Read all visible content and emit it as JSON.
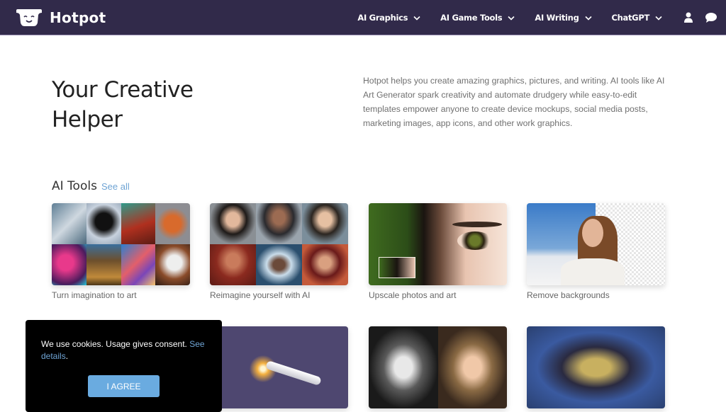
{
  "brand": {
    "name": "Hotpot",
    "bg_color": "#312a4a"
  },
  "nav": {
    "items": [
      {
        "label": "AI Graphics"
      },
      {
        "label": "AI Game Tools"
      },
      {
        "label": "AI Writing"
      },
      {
        "label": "ChatGPT"
      }
    ],
    "icons": [
      "user-icon",
      "chat-icon"
    ]
  },
  "hero": {
    "title": "Your Creative Helper",
    "description": "Hotpot helps you create amazing graphics, pictures, and writing. AI tools like AI Art Generator spark creativity and automate drudgery while easy-to-edit templates empower anyone to create device mockups, social media posts, marketing images, app icons, and other work graphics."
  },
  "ai_tools": {
    "title": "AI Tools",
    "see_all": "See all",
    "cards": [
      {
        "caption": "Turn imagination to art",
        "image": "ai-art-collage"
      },
      {
        "caption": "Reimagine yourself with AI",
        "image": "ai-portraits-collage"
      },
      {
        "caption": "Upscale photos and art",
        "image": "eye-closeup"
      },
      {
        "caption": "Remove backgrounds",
        "image": "woman-background-removed"
      },
      {
        "caption": "",
        "image": "sparkler-pen"
      },
      {
        "caption": "",
        "image": "colorized-portrait"
      },
      {
        "caption": "",
        "image": "mona-lisa-stylized"
      }
    ]
  },
  "cookie_banner": {
    "text": "We use cookies. Usage gives consent. ",
    "link": "See details",
    "after_link": ".",
    "button": "I AGREE",
    "button_color": "#6aabe0",
    "link_color": "#6fa4d4"
  }
}
